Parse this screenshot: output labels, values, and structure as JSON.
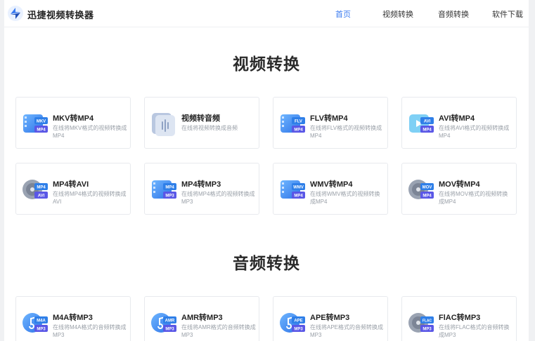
{
  "header": {
    "logo_text": "迅捷视频转换器",
    "nav": [
      "首页",
      "视频转换",
      "音频转换",
      "软件下载"
    ]
  },
  "sections": [
    {
      "title": "视频转换",
      "cards": [
        {
          "title": "MKV转MP4",
          "desc": "在线将MKV格式的视频转换成MP4",
          "icon": "video-file-icon",
          "badge_top": "MKV",
          "badge_bottom": "MP4"
        },
        {
          "title": "视频转音频",
          "desc": "在线将视频转换成音频",
          "icon": "audio-wave-icon",
          "badge_top": "",
          "badge_bottom": ""
        },
        {
          "title": "FLV转MP4",
          "desc": "在线将FLV格式的视频转换成MP4",
          "icon": "video-file-icon",
          "badge_top": "FLV",
          "badge_bottom": "MP4"
        },
        {
          "title": "AVI转MP4",
          "desc": "在线将AVI格式的视频转换成MP4",
          "icon": "video-play-icon",
          "badge_top": "AVI",
          "badge_bottom": "MP4"
        },
        {
          "title": "MP4转AVI",
          "desc": "在线将MP4格式的视频转换成AVI",
          "icon": "film-reel-icon",
          "badge_top": "MP4",
          "badge_bottom": "AVI"
        },
        {
          "title": "MP4转MP3",
          "desc": "在线将MP4格式的视频转换成MP3",
          "icon": "video-file-icon",
          "badge_top": "MP4",
          "badge_bottom": "MP3"
        },
        {
          "title": "WMV转MP4",
          "desc": "在线将WMV格式的视频转换成MP4",
          "icon": "video-file-icon",
          "badge_top": "WMV",
          "badge_bottom": "MP4"
        },
        {
          "title": "MOV转MP4",
          "desc": "在线将MOV格式的视频转换成MP4",
          "icon": "film-reel-icon",
          "badge_top": "MOV",
          "badge_bottom": "MP4"
        }
      ]
    },
    {
      "title": "音频转换",
      "cards": [
        {
          "title": "M4A转MP3",
          "desc": "在线将M4A格式的音频转换成MP3",
          "icon": "music-note-icon",
          "badge_top": "M4A",
          "badge_bottom": "MP3"
        },
        {
          "title": "AMR转MP3",
          "desc": "在线将AMR格式的音频转换成MP3",
          "icon": "microphone-icon",
          "badge_top": "AMR",
          "badge_bottom": "MP3"
        },
        {
          "title": "APE转MP3",
          "desc": "在线将APE格式的音频转换成MP3",
          "icon": "music-note-icon",
          "badge_top": "APE",
          "badge_bottom": "MP3"
        },
        {
          "title": "FlAC转MP3",
          "desc": "在线将FLAC格式的音频转换成MP3",
          "icon": "vinyl-record-icon",
          "badge_top": "FLAC",
          "badge_bottom": "MP3"
        }
      ]
    }
  ],
  "colors": {
    "accent": "#3a7bf0",
    "badge_purple": "#5a57e6",
    "badge_blue": "#2f7fe8"
  }
}
